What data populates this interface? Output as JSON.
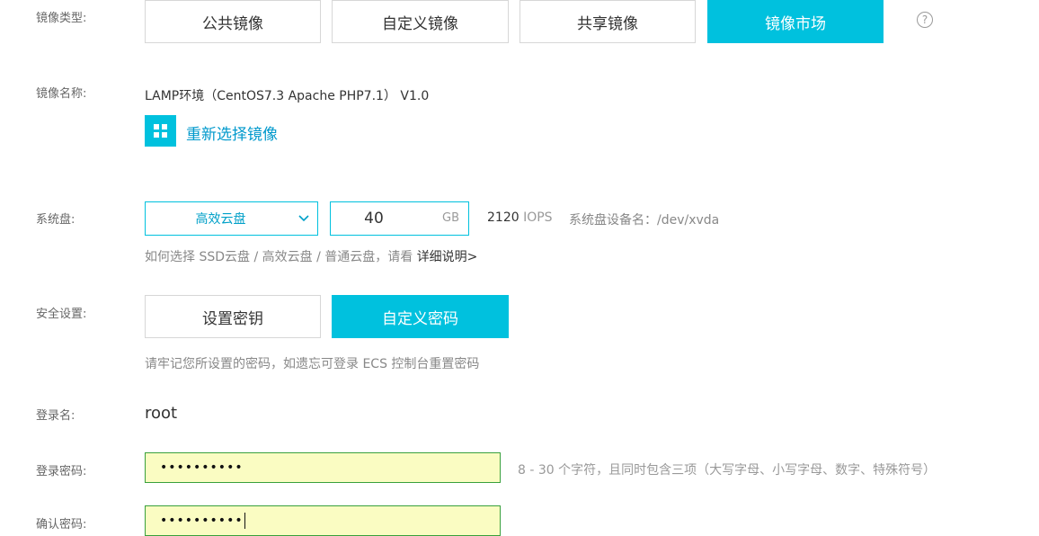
{
  "image_type": {
    "label": "镜像类型:",
    "tabs": [
      {
        "label": "公共镜像",
        "active": false
      },
      {
        "label": "自定义镜像",
        "active": false
      },
      {
        "label": "共享镜像",
        "active": false
      },
      {
        "label": "镜像市场",
        "active": true
      }
    ],
    "help_icon": "question-circle-icon"
  },
  "image_name": {
    "label": "镜像名称:",
    "value": "LAMP环境（CentOS7.3 Apache PHP7.1） V1.0",
    "reselect_label": "重新选择镜像",
    "reselect_icon": "grid-icon"
  },
  "system_disk": {
    "label": "系统盘:",
    "type_value": "高效云盘",
    "size_value": "40",
    "size_unit": "GB",
    "iops_value": "2120",
    "iops_unit": "IOPS",
    "device_label": "系统盘设备名：/dev/xvda",
    "tip_text": "如何选择 SSD云盘 / 高效云盘 / 普通云盘，请看 ",
    "tip_link": "详细说明>"
  },
  "security": {
    "label": "安全设置:",
    "tabs": [
      {
        "label": "设置密钥",
        "active": false
      },
      {
        "label": "自定义密码",
        "active": true
      }
    ],
    "tip": "请牢记您所设置的密码，如遗忘可登录 ECS 控制台重置密码"
  },
  "login": {
    "name_label": "登录名:",
    "name_value": "root",
    "password_label": "登录密码:",
    "password_value": "••••••••••",
    "password_hint": "8 - 30 个字符，且同时包含三项（大写字母、小写字母、数字、特殊符号）",
    "confirm_label": "确认密码:",
    "confirm_value": "••••••••••"
  },
  "colors": {
    "accent": "#00c1de",
    "password_bg": "#fafcc2",
    "password_border": "#39a03c"
  }
}
